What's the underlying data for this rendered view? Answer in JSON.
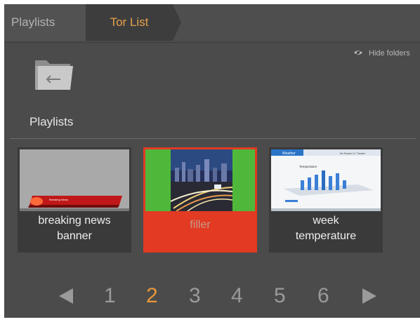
{
  "breadcrumb": {
    "items": [
      {
        "label": "Playlists"
      },
      {
        "label": "Tor List"
      }
    ]
  },
  "toolbar": {
    "hide_folders_label": "Hide folders"
  },
  "folder": {
    "label": "Playlists",
    "icon": "folder-back-icon"
  },
  "items": [
    {
      "name": "breaking news banner",
      "name_line1": "breaking news",
      "name_line2": "banner",
      "thumb_text": "Breaking News",
      "selected": false
    },
    {
      "name": "filler",
      "selected": true
    },
    {
      "name": "week temperature",
      "name_line1": "week",
      "name_line2": "temperature",
      "thumb_header": "Weather",
      "thumb_sub": "Mo Empire 3.1 Theatre",
      "thumb_chart_title": "Temperature",
      "selected": false
    }
  ],
  "pagination": {
    "pages": [
      "1",
      "2",
      "3",
      "4",
      "5",
      "6"
    ],
    "current": "2"
  },
  "colors": {
    "accent": "#e8973a",
    "selected_tile": "#e23a23",
    "panel": "#4b4b4b"
  }
}
